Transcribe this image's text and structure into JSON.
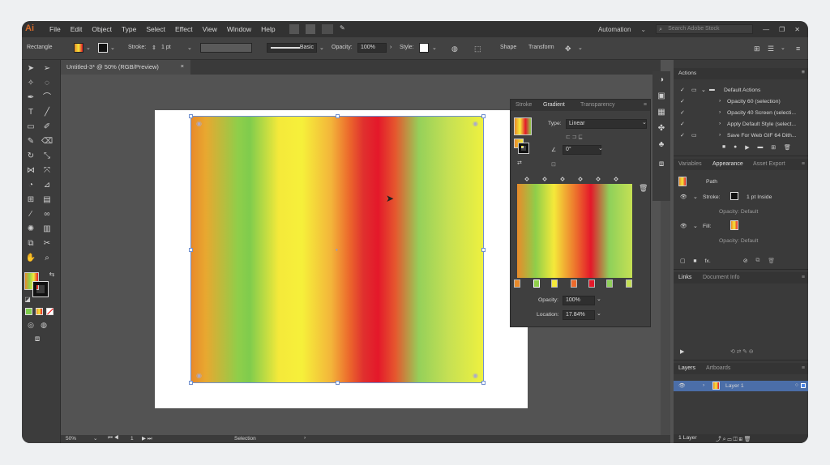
{
  "app": {
    "logo": "Ai"
  },
  "menubar": {
    "items": [
      "File",
      "Edit",
      "Object",
      "Type",
      "Select",
      "Effect",
      "View",
      "Window",
      "Help"
    ],
    "workspace": "Automation",
    "search_placeholder": "Search Adobe Stock"
  },
  "control_bar": {
    "object_type": "Rectangle",
    "stroke_label": "Stroke:",
    "stroke_weight": "1 pt",
    "brush": "Basic",
    "opacity_label": "Opacity:",
    "opacity_value": "100%",
    "style_label": "Style:",
    "shape_label": "Shape",
    "transform_label": "Transform"
  },
  "document": {
    "tab_title": "Untitled-3* @ 50% (RGB/Preview)",
    "tab_close": "×"
  },
  "status": {
    "zoom": "50%",
    "artboard_num": "1",
    "tool": "Selection"
  },
  "gradient_panel": {
    "tabs": [
      "Stroke",
      "Gradient",
      "Transparency"
    ],
    "type_label": "Type:",
    "type_value": "Linear",
    "angle_value": "0°",
    "opacity_label": "Opacity:",
    "opacity_value": "100%",
    "location_label": "Location:",
    "location_value": "17.84%"
  },
  "actions_panel": {
    "title": "Actions",
    "items": [
      "Default Actions",
      "Opacity 60 (selection)",
      "Opacity 40 Screen (selecti...",
      "Apply Default Style (select...",
      "Save For Web GIF 64 Dith..."
    ]
  },
  "appearance_panel": {
    "tabs": [
      "Variables",
      "Appearance",
      "Asset Export"
    ],
    "path_label": "Path",
    "stroke_label": "Stroke:",
    "stroke_value": "1 pt  Inside",
    "stroke_opacity": "Opacity: Default",
    "fill_label": "Fill:",
    "fill_opacity": "Opacity: Default",
    "fx": "fx."
  },
  "links_panel": {
    "tabs": [
      "Links",
      "Document Info"
    ]
  },
  "layers_panel": {
    "tabs": [
      "Layers",
      "Artboards"
    ],
    "layer_name": "Layer 1",
    "footer": "1 Layer"
  },
  "colors": {
    "accent_selection": "#4b6ea8",
    "bounding_box": "#6f8fcf"
  }
}
